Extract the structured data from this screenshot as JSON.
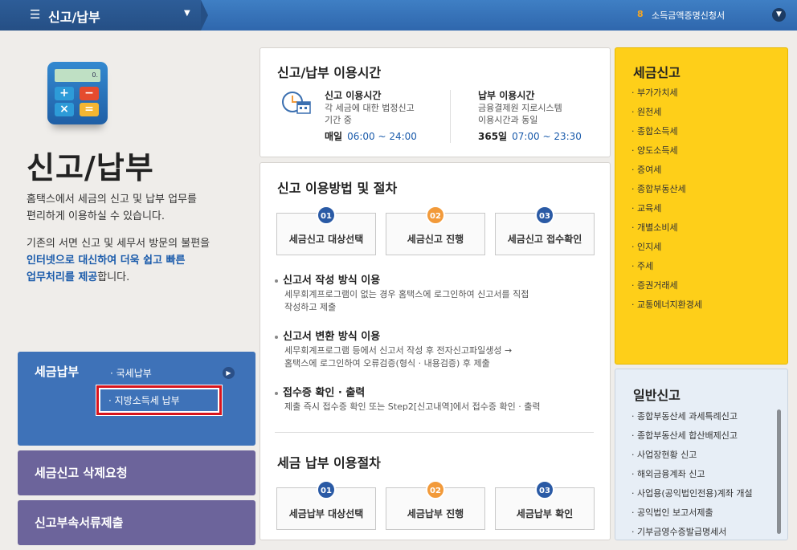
{
  "header": {
    "menu_title": "신고/납부",
    "recent_count": "8",
    "recent_label": "소득금액증명신청서"
  },
  "left": {
    "calc_screen": "0.",
    "title": "신고/납부",
    "desc1": "홈택스에서 세금의 신고 및 납부 업무를",
    "desc2": "편리하게 이용하실 수 있습니다.",
    "desc3": "기존의 서면 신고 및 세무서 방문의 불편을",
    "desc4_em": "인터넷으로 대신하여 더욱 쉽고 빠른",
    "desc5_em": "업무처리를 제공",
    "desc5_tail": "합니다.",
    "pay_title": "세금납부",
    "pay_item1": "· 국세납부",
    "pay_item2": "· 지방소득세 납부",
    "delete_request": "세금신고 삭제요청",
    "attach_submit": "신고부속서류제출"
  },
  "hours": {
    "title": "신고/납부 이용시간",
    "report_label": "신고 이용시간",
    "report_desc1": "각 세금에 대한 법정신고",
    "report_desc2": "기간 중",
    "report_time_label": "매일",
    "report_time": "06:00 ~ 24:00",
    "pay_label": "납부 이용시간",
    "pay_desc1": "금융결제원 지로시스템",
    "pay_desc2": "이용시간과 동일",
    "pay_time_label": "365일",
    "pay_time": "07:00 ~ 23:30"
  },
  "procedure": {
    "title": "신고 이용방법 및 절차",
    "steps": [
      {
        "num": "01",
        "label": "세금신고 대상선택"
      },
      {
        "num": "02",
        "label": "세금신고 진행"
      },
      {
        "num": "03",
        "label": "세금신고 접수확인"
      }
    ],
    "m1_title": "신고서 작성 방식 이용",
    "m1_text1": "세무회계프로그램이 없는 경우 홈택스에 로그인하여 신고서를 직접",
    "m1_text2": "작성하고 제출",
    "m2_title": "신고서 변환 방식 이용",
    "m2_text1": "세무회계프로그램 등에서 신고서 작성 후 전자신고파일생성 →",
    "m2_text2": "홈택스에 로그인하여 오류검증(형식 · 내용검증) 후 제출",
    "m3_title": "접수증 확인 · 출력",
    "m3_text1": "제출 즉시 접수증 확인 또는 Step2[신고내역]에서 접수증 확인 · 출력",
    "pay_title": "세금 납부 이용절차",
    "pay_steps": [
      {
        "num": "01",
        "label": "세금납부 대상선택"
      },
      {
        "num": "02",
        "label": "세금납부 진행"
      },
      {
        "num": "03",
        "label": "세금납부 확인"
      }
    ]
  },
  "tax_report": {
    "title": "세금신고",
    "items": [
      "부가가치세",
      "원천세",
      "종합소득세",
      "양도소득세",
      "증여세",
      "종합부동산세",
      "교육세",
      "개별소비세",
      "인지세",
      "주세",
      "증권거래세",
      "교통에너지환경세"
    ]
  },
  "general_report": {
    "title": "일반신고",
    "items": [
      "종합부동산세 과세특례신고",
      "종합부동산세 합산배제신고",
      "사업장현황 신고",
      "해외금융계좌 신고",
      "사업용(공익법인전용)계좌 개설",
      "공익법인 보고서제출",
      "기부금영수증발급명세서"
    ]
  }
}
